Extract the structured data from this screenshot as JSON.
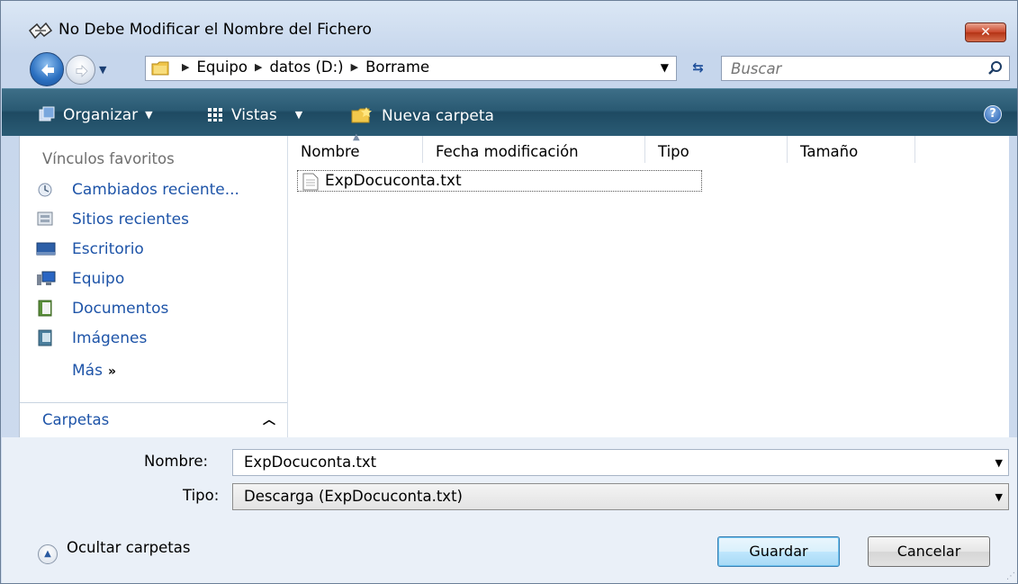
{
  "window": {
    "title": "No Debe Modificar el Nombre del Fichero",
    "close_label": "✕"
  },
  "nav": {
    "breadcrumbs": [
      "Equipo",
      "datos (D:)",
      "Borrame"
    ],
    "search_placeholder": "Buscar"
  },
  "toolbar": {
    "organize_label": "Organizar",
    "views_label": "Vistas",
    "new_folder_label": "Nueva carpeta",
    "help_label": "?"
  },
  "sidebar": {
    "favorites_title": "Vínculos favoritos",
    "items": [
      {
        "label": "Cambiados reciente...",
        "icon": "recent-changes-icon"
      },
      {
        "label": "Sitios recientes",
        "icon": "recent-places-icon"
      },
      {
        "label": "Escritorio",
        "icon": "desktop-icon"
      },
      {
        "label": "Equipo",
        "icon": "computer-icon"
      },
      {
        "label": "Documentos",
        "icon": "documents-icon"
      },
      {
        "label": "Imágenes",
        "icon": "pictures-icon"
      }
    ],
    "more_label": "Más",
    "more_chevron": "»",
    "folders_label": "Carpetas"
  },
  "files": {
    "columns": [
      "Nombre",
      "Fecha modificación",
      "Tipo",
      "Tamaño"
    ],
    "rows": [
      {
        "name": "ExpDocuconta.txt"
      }
    ]
  },
  "form": {
    "name_label": "Nombre:",
    "name_value": "ExpDocuconta.txt",
    "type_label": "Tipo:",
    "type_value": "Descarga (ExpDocuconta.txt)",
    "hide_folders_label": "Ocultar carpetas",
    "save_label": "Guardar",
    "cancel_label": "Cancelar"
  },
  "colors": {
    "toolbar": "#2a5a73",
    "link": "#1e54a8",
    "close": "#c9462a"
  }
}
